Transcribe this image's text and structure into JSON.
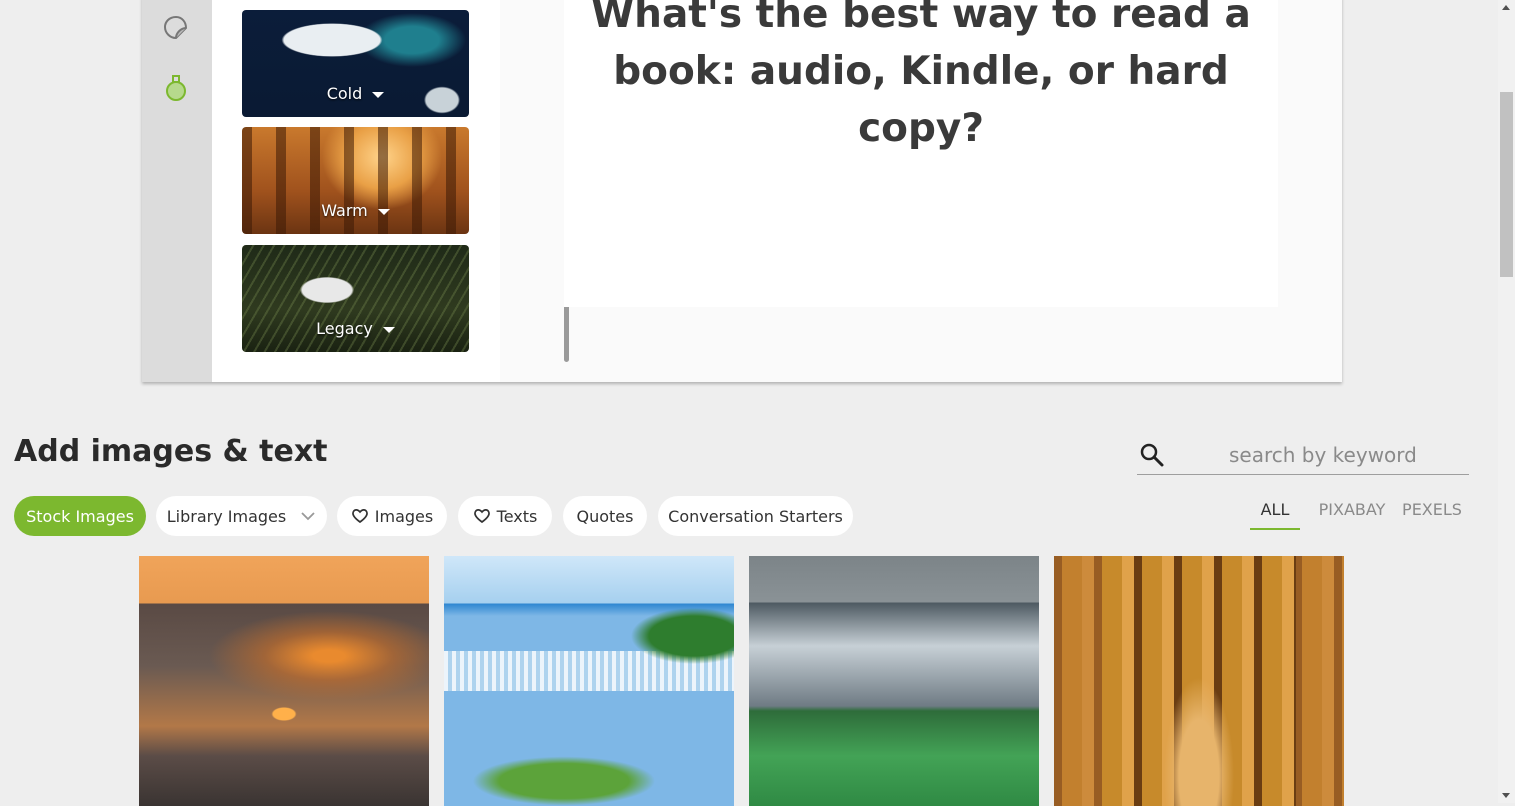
{
  "editor": {
    "tools": [
      {
        "icon": "sticker-icon"
      },
      {
        "icon": "flask-icon"
      }
    ],
    "filters": [
      {
        "label": "Cold"
      },
      {
        "label": "Warm"
      },
      {
        "label": "Legacy"
      }
    ],
    "slide_text": "What's the best way to read a book: audio, Kindle, or hard copy?"
  },
  "section": {
    "title": "Add images & text",
    "search_placeholder": "search by keyword",
    "chips": {
      "stock": "Stock Images",
      "library": "Library Images",
      "images": "Images",
      "texts": "Texts",
      "quotes": "Quotes",
      "conversation": "Conversation Starters"
    },
    "sources": {
      "all": "ALL",
      "pixabay": "PIXABAY",
      "pexels": "PEXELS"
    },
    "active_source": "ALL",
    "active_chip": "Stock Images"
  },
  "colors": {
    "accent": "#7cb82f",
    "background": "#eeeeee"
  }
}
